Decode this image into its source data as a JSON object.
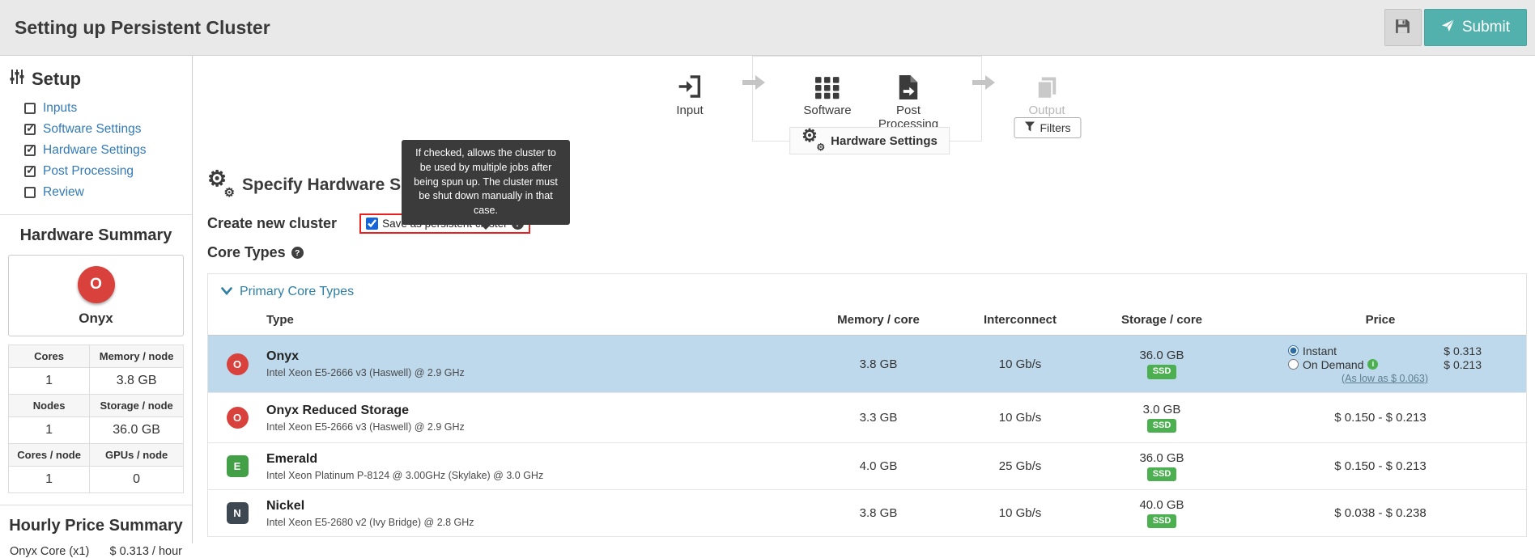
{
  "colors": {
    "submit_teal": "#53b1ad",
    "selected_row_blue": "#bed9ec",
    "ssd_green": "#4caf50",
    "onyx_red": "#d9413d",
    "emerald_green": "#43a047",
    "nickel_dark": "#3d4852",
    "highlight_red": "#ec1f1f",
    "sidebar_link_blue": "#337ab7",
    "tooltip_bg": "#3b3b3b"
  },
  "header": {
    "title": "Setting up Persistent Cluster",
    "submit_label": "Submit"
  },
  "sidebar": {
    "setup_title": "Setup",
    "nav": [
      {
        "label": "Inputs",
        "checked": false
      },
      {
        "label": "Software Settings",
        "checked": true
      },
      {
        "label": "Hardware Settings",
        "checked": true
      },
      {
        "label": "Post Processing",
        "checked": true
      },
      {
        "label": "Review",
        "checked": false
      }
    ],
    "hardware_summary": {
      "title": "Hardware Summary",
      "core_badge": "O",
      "core_name": "Onyx",
      "stats": [
        {
          "l1": "Cores",
          "l2": "Memory / node",
          "v1": "1",
          "v2": "3.8 GB"
        },
        {
          "l1": "Nodes",
          "l2": "Storage / node",
          "v1": "1",
          "v2": "36.0 GB"
        },
        {
          "l1": "Cores / node",
          "l2": "GPUs / node",
          "v1": "1",
          "v2": "0"
        }
      ]
    },
    "hourly_price_summary": {
      "title": "Hourly Price Summary",
      "rows": [
        {
          "label": "Onyx Core (x1)",
          "value": "$ 0.313 / hour"
        }
      ]
    }
  },
  "workflow": {
    "input_label": "Input",
    "software_label": "Software",
    "post_processing_label": "Post Processing",
    "output_label": "Output",
    "hardware_settings_tab": "Hardware Settings",
    "filters_label": "Filters"
  },
  "tooltip_text": "If checked, allows the cluster to be used by multiple jobs after being spun up. The cluster must be shut down manually in that case.",
  "main": {
    "heading": "Specify Hardware Settings",
    "create_cluster_label": "Create new cluster",
    "persistent_checkbox_label": "Save as persistent cluster",
    "core_types_label": "Core Types",
    "primary_core_types_label": "Primary Core Types",
    "table": {
      "headers": [
        "Type",
        "Memory / core",
        "Interconnect",
        "Storage / core",
        "Price"
      ],
      "rows": [
        {
          "badge": "O",
          "name": "Onyx",
          "cpu": "Intel Xeon E5-2666 v3 (Haswell) @ 2.9 GHz",
          "memory": "3.8 GB",
          "interconnect": "10 Gb/s",
          "storage": "36.0 GB",
          "storage_type": "SSD",
          "selected": true,
          "price_options": [
            {
              "label": "Instant",
              "price": "$ 0.313",
              "selected": true
            },
            {
              "label": "On Demand",
              "price": "$ 0.213",
              "selected": false
            }
          ],
          "price_note": "(As low as $ 0.063)"
        },
        {
          "badge": "O",
          "name": "Onyx Reduced Storage",
          "cpu": "Intel Xeon E5-2666 v3 (Haswell) @ 2.9 GHz",
          "memory": "3.3 GB",
          "interconnect": "10 Gb/s",
          "storage": "3.0 GB",
          "storage_type": "SSD",
          "selected": false,
          "price_range": "$ 0.150 - $ 0.213"
        },
        {
          "badge": "E",
          "name": "Emerald",
          "cpu": "Intel Xeon Platinum P-8124 @ 3.00GHz (Skylake) @ 3.0 GHz",
          "memory": "4.0 GB",
          "interconnect": "25 Gb/s",
          "storage": "36.0 GB",
          "storage_type": "SSD",
          "selected": false,
          "price_range": "$ 0.150 - $ 0.213"
        },
        {
          "badge": "N",
          "name": "Nickel",
          "cpu": "Intel Xeon E5-2680 v2 (Ivy Bridge) @ 2.8 GHz",
          "memory": "3.8 GB",
          "interconnect": "10 Gb/s",
          "storage": "40.0 GB",
          "storage_type": "SSD",
          "selected": false,
          "price_range": "$ 0.038 - $ 0.238"
        }
      ]
    }
  }
}
